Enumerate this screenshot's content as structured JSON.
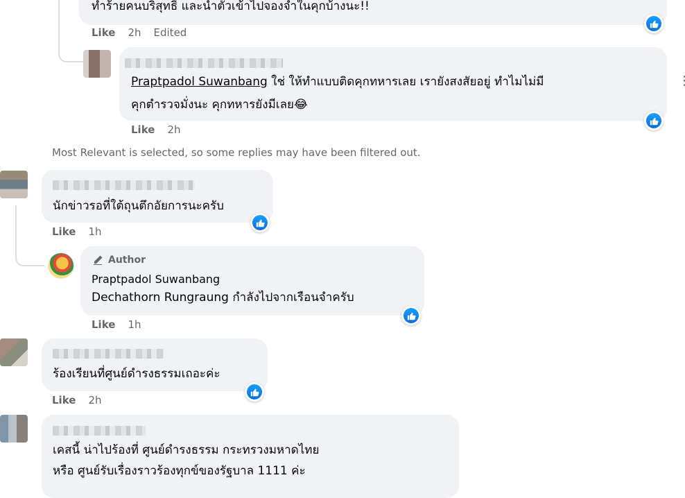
{
  "comments": {
    "c0": {
      "text_line": "ทำร้ายคนบริสุทธิ์ และนำตัวเข้าไปจองจำในคุกบ้างนะ!!",
      "like_label": "Like",
      "time": "2h",
      "edited_label": "Edited"
    },
    "c1": {
      "mention": "Praptpadol Suwanbang",
      "text_line1": " ใช่ ให้ทำแบบติดคุกทหารเลย เรายังสงสัยอยู่ ทำไมไม่มี",
      "text_line2": "คุกตำรวจมั่งนะ คุกทหารยังมีเลย😂",
      "like_label": "Like",
      "time": "2h"
    },
    "c2": {
      "text_line": "นักข่าวรอที่ใต้ถุนตึกอัยการนะครับ",
      "like_label": "Like",
      "time": "1h"
    },
    "c3": {
      "author_label": "Author",
      "author_name": "Praptpadol Suwanbang",
      "mention": "Dechathorn Rungraung",
      "text_line": " กำลังไปจากเรือนจำครับ",
      "like_label": "Like",
      "time": "1h"
    },
    "c4": {
      "text_line": "ร้องเรียนที่ศูนย์ดำรงธรรมเถอะค่ะ",
      "like_label": "Like",
      "time": "2h"
    },
    "c5": {
      "text_line1": "เคสนี้ น่าไปร้องที่ ศูนย์ดำรงธรรม กระทรวงมหาดไทย",
      "text_line2": "หรือ ศูนย์รับเรื่องราวร้องทุกข์ของรัฐบาล 1111 ค่ะ"
    }
  },
  "filter_notice": "Most Relevant is selected, so some replies may have been filtered out.",
  "icons": {
    "like_badge": "thumbs-up-icon",
    "more": "more-options-icon",
    "author_badge": "pencil-icon"
  },
  "colors": {
    "bubble": "#f0f2f5",
    "like_blue": "#0a6de0",
    "meta_gray": "#65676b"
  }
}
